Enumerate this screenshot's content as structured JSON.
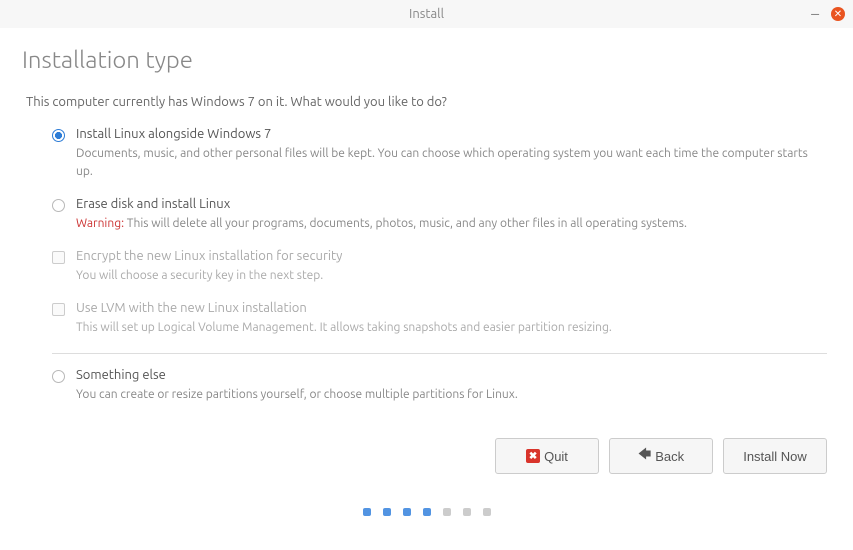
{
  "titlebar": {
    "title": "Install"
  },
  "header": {
    "title": "Installation type"
  },
  "intro": "This computer currently has Windows 7 on it. What would you like to do?",
  "options": {
    "alongside": {
      "title": "Install Linux alongside Windows 7",
      "desc": "Documents, music, and other personal files will be kept. You can choose which operating system you want each time the computer starts up."
    },
    "erase": {
      "title": "Erase disk and install Linux",
      "warn": "Warning:",
      "desc": " This will delete all your programs, documents, photos, music, and any other files in all operating systems."
    },
    "encrypt": {
      "title": "Encrypt the new Linux installation for security",
      "desc": "You will choose a security key in the next step."
    },
    "lvm": {
      "title": "Use LVM with the new Linux installation",
      "desc": "This will set up Logical Volume Management. It allows taking snapshots and easier partition resizing."
    },
    "other": {
      "title": "Something else",
      "desc": "You can create or resize partitions yourself, or choose multiple partitions for Linux."
    }
  },
  "buttons": {
    "quit": "Quit",
    "back": "Back",
    "install": "Install Now"
  }
}
